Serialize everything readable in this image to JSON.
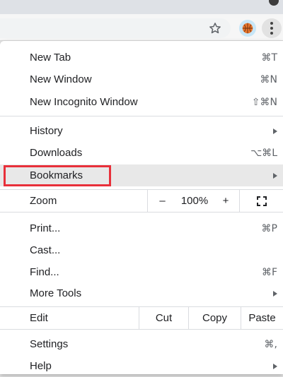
{
  "menu": {
    "group1": [
      {
        "label": "New Tab",
        "shortcut": "⌘T"
      },
      {
        "label": "New Window",
        "shortcut": "⌘N"
      },
      {
        "label": "New Incognito Window",
        "shortcut": "⇧⌘N"
      }
    ],
    "group2": [
      {
        "label": "History",
        "submenu": true
      },
      {
        "label": "Downloads",
        "shortcut": "⌥⌘L"
      },
      {
        "label": "Bookmarks",
        "submenu": true,
        "highlighted": true
      }
    ],
    "zoom": {
      "label": "Zoom",
      "minus": "–",
      "level": "100%",
      "plus": "+"
    },
    "group3": [
      {
        "label": "Print...",
        "shortcut": "⌘P"
      },
      {
        "label": "Cast..."
      },
      {
        "label": "Find...",
        "shortcut": "⌘F"
      },
      {
        "label": "More Tools",
        "submenu": true
      }
    ],
    "edit": {
      "label": "Edit",
      "cut": "Cut",
      "copy": "Copy",
      "paste": "Paste"
    },
    "group4": [
      {
        "label": "Settings",
        "shortcut": "⌘,"
      },
      {
        "label": "Help",
        "submenu": true
      }
    ]
  },
  "colors": {
    "highlight_box": "#e8303a",
    "hover_row": "#e8e8e8"
  },
  "icons": {
    "star": "bookmark-star-icon",
    "avatar": "basketball-avatar",
    "kebab": "three-dots-menu-icon",
    "fullscreen": "fullscreen-icon"
  }
}
